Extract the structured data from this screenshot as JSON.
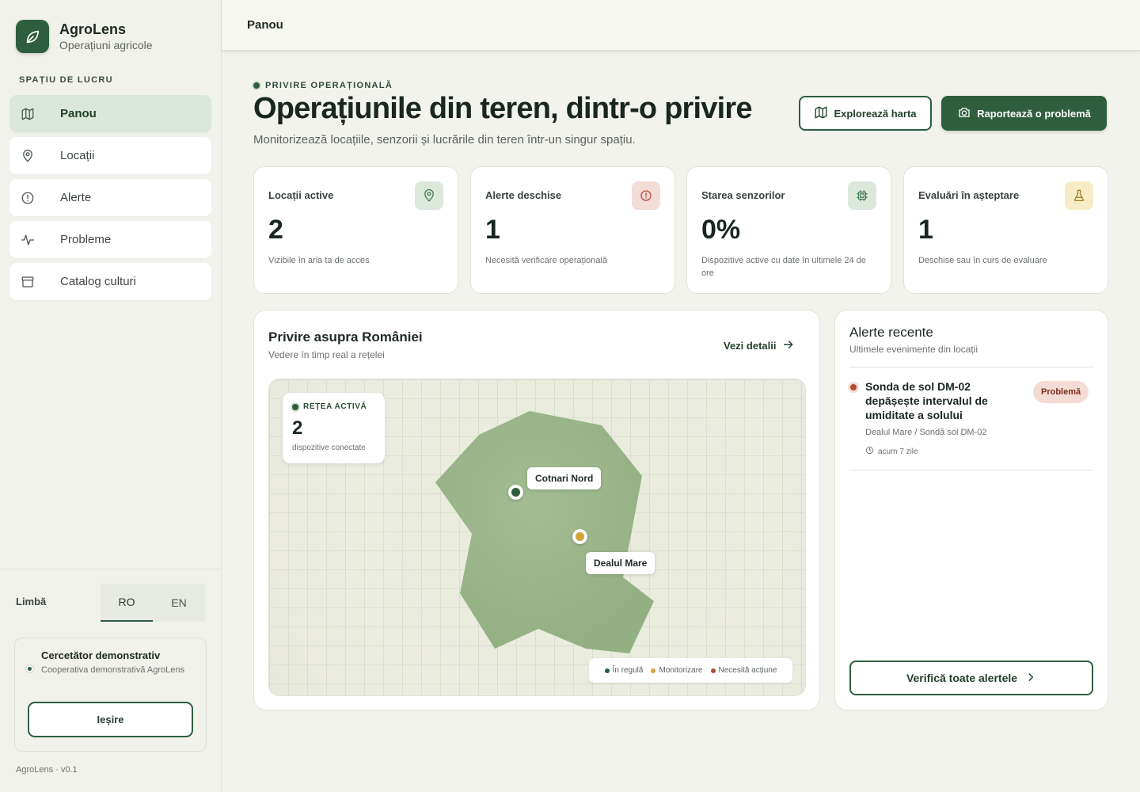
{
  "brand": {
    "name": "AgroLens",
    "subtitle": "Operațiuni agricole"
  },
  "sidebar": {
    "section_label": "SPAȚIU DE LUCRU",
    "items": [
      {
        "label": "Panou",
        "icon": "map-icon",
        "active": true
      },
      {
        "label": "Locații",
        "icon": "location-pin-icon",
        "active": false
      },
      {
        "label": "Alerte",
        "icon": "alert-circle-icon",
        "active": false
      },
      {
        "label": "Probleme",
        "icon": "activity-icon",
        "active": false
      },
      {
        "label": "Catalog culturi",
        "icon": "archive-box-icon",
        "active": false
      }
    ],
    "language": {
      "label": "Limbă",
      "options": [
        "RO",
        "EN"
      ],
      "selected": "RO"
    },
    "user": {
      "name": "Cercetător demonstrativ",
      "organization": "Cooperativa demonstrativă AgroLens",
      "logout_label": "Ieșire"
    },
    "version": "AgroLens · v0.1"
  },
  "topbar": {
    "title": "Panou"
  },
  "header": {
    "eyebrow": "PRIVIRE OPERAȚIONALĂ",
    "title": "Operațiunile din teren, dintr-o privire",
    "subtitle": "Monitorizează locațiile, senzorii și lucrările din teren într-un singur spațiu.",
    "explore_label": "Explorează harta",
    "report_label": "Raportează o problemă"
  },
  "stats": [
    {
      "title": "Locații active",
      "value": "2",
      "description": "Vizibile în aria ta de acces",
      "icon": "location-pin-icon",
      "icon_bg": "#dde8dd",
      "icon_color": "#3f7a4d"
    },
    {
      "title": "Alerte deschise",
      "value": "1",
      "description": "Necesită verificare operațională",
      "icon": "alert-circle-icon",
      "icon_bg": "#f4dcd6",
      "icon_color": "#b34a35"
    },
    {
      "title": "Starea senzorilor",
      "value": "0%",
      "description": "Dispozitive active cu date în ultimele 24 de ore",
      "icon": "chip-icon",
      "icon_bg": "#dde8dd",
      "icon_color": "#3f7a4d"
    },
    {
      "title": "Evaluări în așteptare",
      "value": "1",
      "description": "Deschise sau în curs de evaluare",
      "icon": "flask-icon",
      "icon_bg": "#f6ecc5",
      "icon_color": "#9a7a1c"
    }
  ],
  "map": {
    "title": "Privire asupra României",
    "subtitle": "Vedere în timp real a rețelei",
    "details_label": "Vezi detalii",
    "network": {
      "label": "REȚEA ACTIVĂ",
      "value": "2",
      "caption": "dispozitive conectate"
    },
    "locations": [
      {
        "name": "Cotnari Nord",
        "status": "ok",
        "color": "#2f5e3e"
      },
      {
        "name": "Dealul Mare",
        "status": "monitoring",
        "color": "#d4a437"
      }
    ],
    "legend": [
      {
        "label": "În regulă",
        "color": "#2f5e3e"
      },
      {
        "label": "Monitorizare",
        "color": "#d4a437"
      },
      {
        "label": "Necesită acțiune",
        "color": "#b34a35"
      }
    ]
  },
  "alerts": {
    "title": "Alerte recente",
    "subtitle": "Ultimele evenimente din locații",
    "items": [
      {
        "title": "Sonda de sol DM-02 depășește intervalul de umiditate a solului",
        "badge": "Problemă",
        "location": "Dealul Mare / Sondă sol DM-02",
        "time": "acum 7 zile"
      }
    ],
    "button_label": "Verifică toate alertele"
  },
  "colors": {
    "accent": "#2f5e3e",
    "background": "#f3f3ee",
    "danger": "#b34a35",
    "warning": "#d4a437"
  }
}
